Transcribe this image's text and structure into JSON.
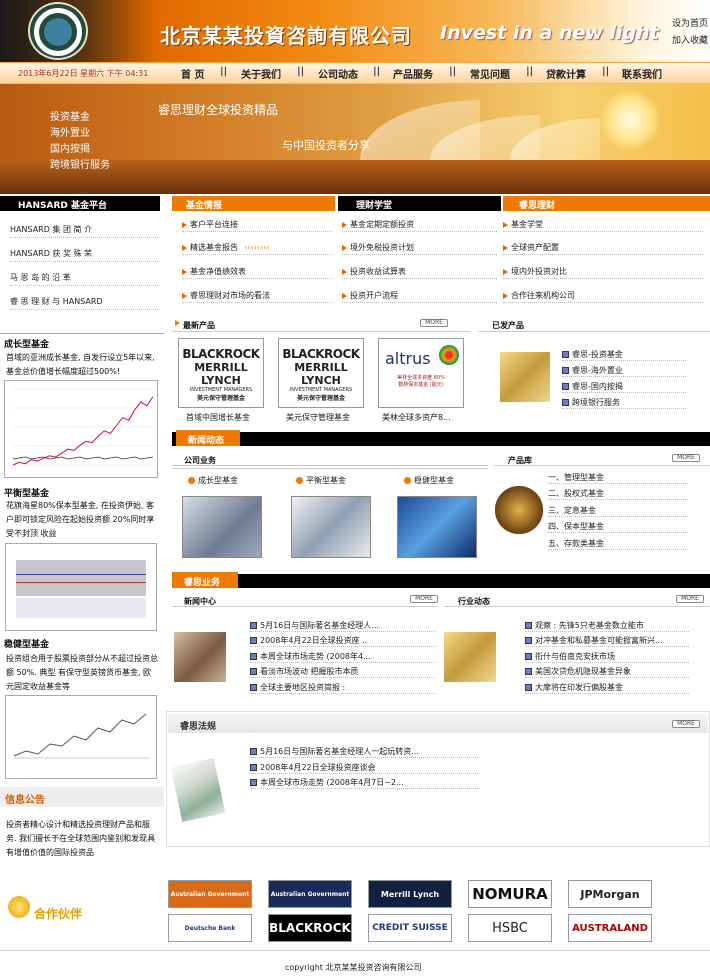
{
  "header": {
    "company_name": "北京某某投資咨詢有限公司",
    "slogan": "Invest in a new light",
    "set_home": "设为首页",
    "add_favorite": "加入收藏",
    "logo_text": "WEALTH SPRING HOLDINGS"
  },
  "nav": {
    "date": "2013年6月22日 星期六 下午 04:31",
    "items": [
      "首 页",
      "关于我们",
      "公司动态",
      "产品服务",
      "常见问题",
      "贷款计算",
      "联系我们"
    ],
    "separator": "||"
  },
  "banner": {
    "menu": [
      "投资基金",
      "海外置业",
      "国内按揭",
      "跨境银行服务"
    ],
    "title1": "睿思理财全球投资精品",
    "title2": "与中国投资者分享"
  },
  "sidebar": {
    "platform_title": "HANSARD 基金平台",
    "platform_items": [
      "HANSARD 集 团 简 介",
      "HANSARD 获 奖 殊 荣",
      "马 恩 岛 的 沿 革",
      "睿 思 理 财 与 HANSARD"
    ],
    "growth_title": "成长型基金",
    "growth_text": "首域的亚洲成长基金, 自发行设立5年以来, 基金总价值增长幅度超过500%!",
    "balanced_title": "平衡型基金",
    "balanced_text": "花旗海星80%保本型基金, 在投资伊始, 客户即可锁定风险在起始投资额 20%同时享受不封顶 收益",
    "stable_title": "稳健型基金",
    "stable_text": "投资组合用于股票投资部分从不超过投资总额 50%. 典型 有保守型英镑货币基金, 欧元固定收益基金等",
    "notice_title": "信息公告",
    "notice_text": "投资者精心设计和精选投资理财产品和服务. 我们擅长于在全球范围内鉴别和发现具有增值价值的国际投资品",
    "partner_label": "合作伙伴"
  },
  "columns": {
    "fund": {
      "title": "基金情报",
      "items": [
        "客户平台连接",
        "精选基金报告",
        "基金净值绩效表",
        "睿思理财对市场的看法"
      ]
    },
    "school": {
      "title": "理财学堂",
      "items": [
        "基金定期定额投资",
        "境外免税投资计划",
        "投资收益试算表",
        "投资开户流程"
      ]
    },
    "rethink": {
      "title": "睿思理财",
      "items": [
        "基金学堂",
        "全球资产配置",
        "境内外投资对比",
        "合作往来机构公司"
      ]
    }
  },
  "latest": {
    "title": "最新产品",
    "more": "MORE",
    "products": [
      {
        "logo1": "BLACKROCK",
        "logo2": "MERRILL LYNCH",
        "logo3": "INVESTMENT MANAGERS",
        "logo4": "美元保守管理基金",
        "caption": "首域中国增长基金"
      },
      {
        "logo1": "BLACKROCK",
        "logo2": "MERRILL LYNCH",
        "logo3": "INVESTMENT MANAGERS",
        "logo4": "美元保守管理基金",
        "caption": "美元保守管理基金"
      },
      {
        "logo1": "altrus",
        "logo2": "美林全球多資產 80%",
        "logo3": "動態保本基金 (歐元)",
        "logo4": "",
        "caption": "美林全球多资产8..."
      }
    ]
  },
  "issued": {
    "title": "已发产品",
    "items": [
      "睿思-投资基金",
      "睿思-海外置业",
      "睿思-国内按揭",
      "跨境银行服务"
    ]
  },
  "news": {
    "title": "新闻动态",
    "company": {
      "title": "公司业务",
      "more": "MORE",
      "types": [
        "成长型基金",
        "平衡型基金",
        "稳健型基金"
      ]
    },
    "products": {
      "title": "产品库",
      "more": "MORE",
      "items": [
        "一、管理型基金",
        "二、股权式基金",
        "三、定息基金",
        "四、保本型基金",
        "五、存款类基金"
      ]
    }
  },
  "business": {
    "title": "睿思业务",
    "center": {
      "title": "新闻中心",
      "more": "MORE",
      "items": [
        "5月16日与国际著名基金经理人...",
        "2008年4月22日全球投资座 ..",
        "本周全球市场走势 (2008年4...",
        "看淡市场波动 把握股市本质",
        "全球主要地区投资简报 :"
      ]
    },
    "industry": {
      "title": "行业动态",
      "more": "MORE",
      "items": [
        "观察 : 先锋5只老基金数立能市",
        "对冲基金和私募基金可能掀富新兴...",
        "衔什与伯南克安抚市场",
        "美国次贷危机隐现基金异象",
        "大摩将在印发行偏股基金"
      ]
    }
  },
  "regs": {
    "title": "睿思法规",
    "more": "MORE",
    "items": [
      "5月16日与国际著名基金经理人一起玩转资...",
      "2008年4月22日全球投资座谈会",
      "本周全球市场走势 (2008年4月7日~2..."
    ]
  },
  "partners": [
    "Australian Government",
    "Australian Government",
    "Merrill Lynch",
    "NOMURA",
    "JPMorgan",
    "Deutsche Bank",
    "BLACKROCK",
    "CREDIT SUISSE",
    "HSBC",
    "AUSTRALAND"
  ],
  "footer": {
    "copyright": "copyright 北京某某投资咨询有限公司"
  },
  "chart_growth": {
    "type": "line",
    "series": [
      {
        "values": [
          10,
          12,
          11,
          14,
          13,
          15,
          17,
          16,
          19,
          22,
          21,
          25,
          28,
          27,
          32,
          36,
          34,
          40,
          46,
          44,
          52,
          58,
          55,
          62
        ]
      }
    ]
  },
  "colors": {
    "brand_orange": "#f07a00",
    "black": "#000000"
  }
}
